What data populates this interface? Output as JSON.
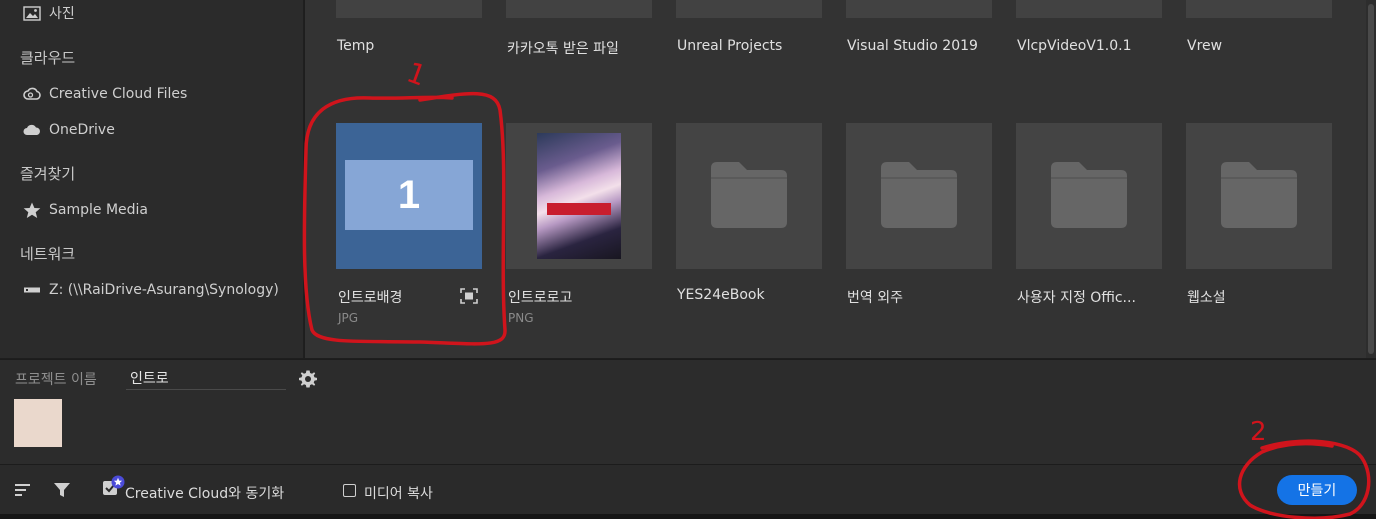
{
  "sidebar": {
    "photos_label": "사진",
    "cloud_header": "클라우드",
    "cloud_items": [
      {
        "label": "Creative Cloud Files",
        "icon": "creative-cloud-icon"
      },
      {
        "label": "OneDrive",
        "icon": "cloud-icon"
      }
    ],
    "favorites_header": "즐겨찾기",
    "favorites_items": [
      {
        "label": "Sample Media",
        "icon": "star-icon"
      }
    ],
    "network_header": "네트워크",
    "network_items": [
      {
        "label": "Z: (\\\\RaiDrive-Asurang\\Synology)",
        "icon": "network-drive-icon"
      }
    ]
  },
  "grid": {
    "top_row": [
      {
        "name": "Temp"
      },
      {
        "name": "카카오톡 받은 파일"
      },
      {
        "name": "Unreal Projects"
      },
      {
        "name": "Visual Studio 2019"
      },
      {
        "name": "VlcpVideoV1.0.1"
      },
      {
        "name": "Vrew"
      }
    ],
    "bottom_row": [
      {
        "name": "인트로배경",
        "type": "JPG",
        "thumb_text": "1",
        "selected": true
      },
      {
        "name": "인트로로고",
        "type": "PNG"
      },
      {
        "name": "YES24eBook"
      },
      {
        "name": "번역 외주"
      },
      {
        "name": "사용자 지정 Offic..."
      },
      {
        "name": "웹소설"
      }
    ]
  },
  "project": {
    "label": "프로젝트 이름",
    "name_value": "인트로",
    "swatch_color": "#ead8cc"
  },
  "toolbar": {
    "sync_label": "Creative Cloud와 동기화",
    "copy_media_label": "미디어 복사",
    "create_label": "만들기"
  },
  "annotations": {
    "mark_1": "1",
    "mark_2": "2",
    "color": "#d0141c"
  },
  "colors": {
    "accent": "#1473e6",
    "selected_tile": "#3c6496"
  }
}
